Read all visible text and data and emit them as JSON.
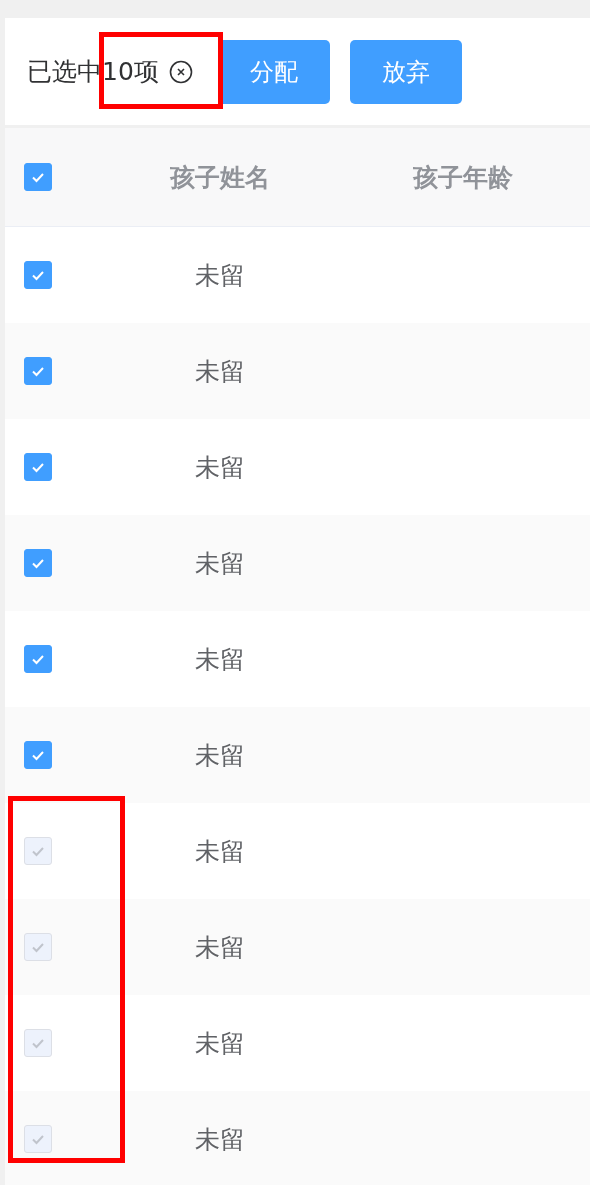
{
  "toolbar": {
    "selection_text": "已选中10项",
    "buttons": [
      "分配",
      "放弃"
    ]
  },
  "table": {
    "header_checkbox": {
      "checked": true
    },
    "columns": [
      "孩子姓名",
      "孩子年龄"
    ],
    "rows": [
      {
        "checked": true,
        "disabled": false,
        "name": "未留"
      },
      {
        "checked": true,
        "disabled": false,
        "name": "未留"
      },
      {
        "checked": true,
        "disabled": false,
        "name": "未留"
      },
      {
        "checked": true,
        "disabled": false,
        "name": "未留"
      },
      {
        "checked": true,
        "disabled": false,
        "name": "未留"
      },
      {
        "checked": true,
        "disabled": false,
        "name": "未留"
      },
      {
        "checked": true,
        "disabled": true,
        "name": "未留"
      },
      {
        "checked": true,
        "disabled": true,
        "name": "未留"
      },
      {
        "checked": true,
        "disabled": true,
        "name": "未留"
      },
      {
        "checked": true,
        "disabled": true,
        "name": "未留"
      }
    ]
  }
}
